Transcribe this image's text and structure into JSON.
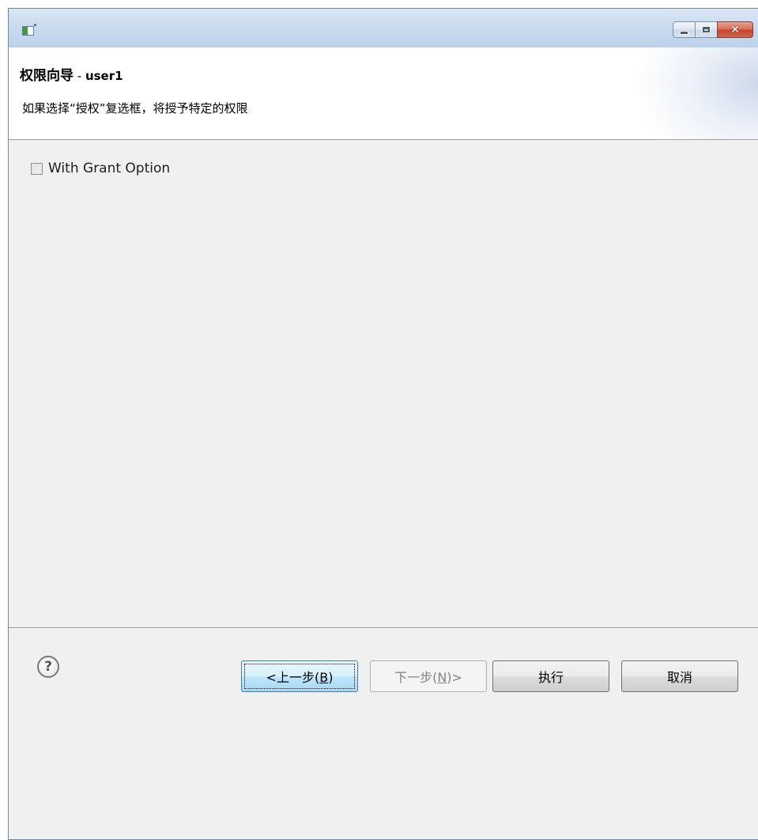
{
  "window": {
    "controls": {
      "minimize_icon": "minimize-icon",
      "maximize_icon": "maximize-icon",
      "close_icon": "close-icon",
      "close_color": "#c5432c"
    }
  },
  "header": {
    "title_main": "权限向导",
    "title_sep": " - ",
    "title_user": "user1",
    "description": "如果选择“授权”复选框，将授予特定的权限"
  },
  "content": {
    "with_grant_option": {
      "label": "With Grant Option",
      "checked": false
    }
  },
  "footer": {
    "help_icon": "help-icon",
    "help_glyph": "?",
    "back_button": {
      "prefix": "<上一步(",
      "mnemonic": "B",
      "suffix": ")",
      "enabled": true,
      "focused": true
    },
    "next_button": {
      "prefix": "下一步(",
      "mnemonic": "N",
      "suffix": ")>",
      "enabled": false
    },
    "execute_button": {
      "label": "执行",
      "enabled": true
    },
    "cancel_button": {
      "label": "取消",
      "enabled": true
    }
  }
}
